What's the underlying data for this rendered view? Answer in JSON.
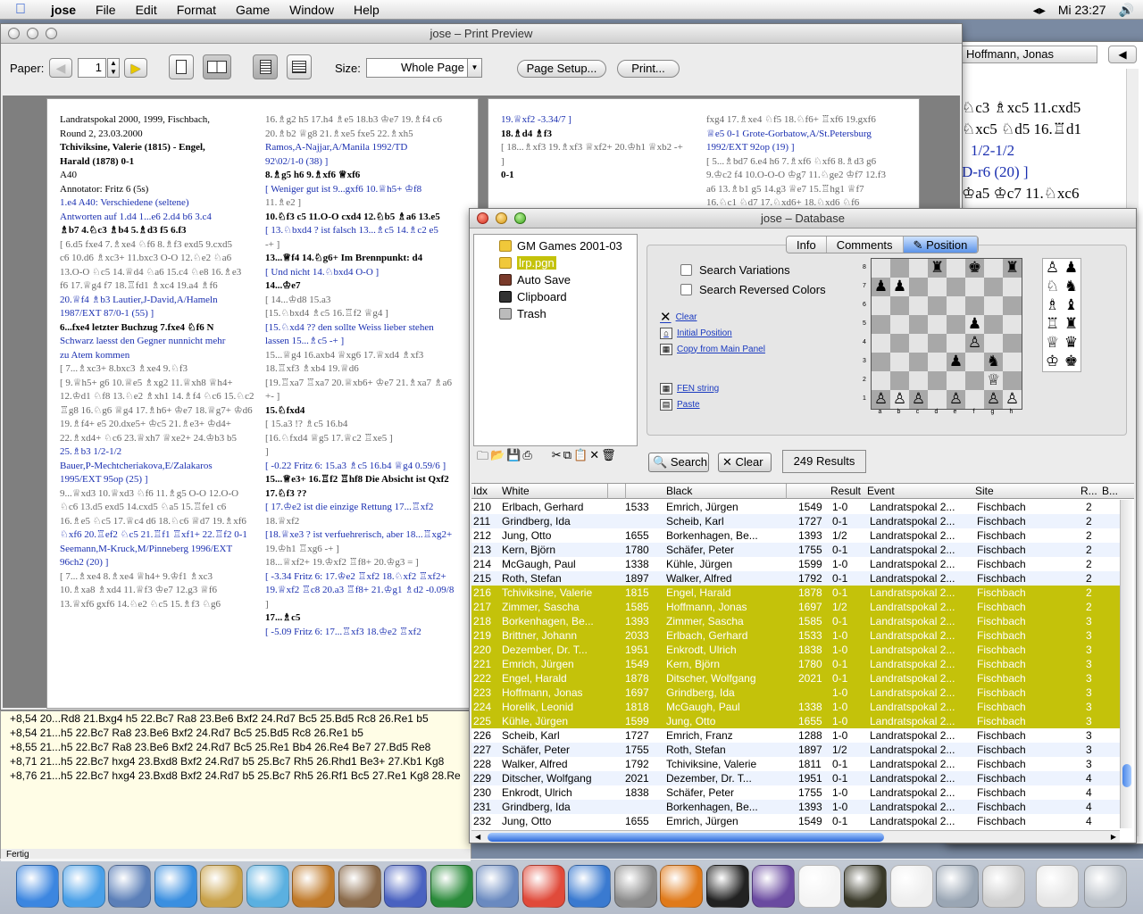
{
  "menubar": {
    "app": "jose",
    "items": [
      "File",
      "Edit",
      "Format",
      "Game",
      "Window",
      "Help"
    ],
    "clock": "Mi 23:27"
  },
  "print": {
    "title": "jose – Print Preview",
    "paper_label": "Paper:",
    "page_value": "1",
    "size_label": "Size:",
    "size_value": "Whole Page",
    "setup": "Page Setup...",
    "print": "Print..."
  },
  "page1": {
    "left": [
      {
        "t": "Landratspokal 2000, 1999, Fischbach,",
        "c": ""
      },
      {
        "t": "Round 2, 23.03.2000",
        "c": ""
      },
      {
        "t": "Tchiviksine, Valerie (1815)  - Engel,",
        "c": "b"
      },
      {
        "t": "Harald (1878)   0-1",
        "c": "b"
      },
      {
        "t": "A40",
        "c": ""
      },
      {
        "t": "",
        "c": ""
      },
      {
        "t": "Annotator: Fritz 6 (5s)",
        "c": ""
      },
      {
        "t": "",
        "c": ""
      },
      {
        "t": "1.e4 A40: Verschiedene (seltene)",
        "c": "blue"
      },
      {
        "t": "Antworten auf 1.d4 1...e6 2.d4 b6 3.c4",
        "c": "blue"
      },
      {
        "t": "♗b7 4.♘c3 ♗b4 5.♗d3 f5 6.f3",
        "c": "b"
      },
      {
        "t": "[ 6.d5 fxe4 7.♗xe4 ♘f6 8.♗f3 exd5 9.cxd5",
        "c": "grey"
      },
      {
        "t": "c6 10.d6 ♗xc3+ 11.bxc3 O-O 12.♘e2 ♘a6",
        "c": "grey"
      },
      {
        "t": "13.O-O ♘c5 14.♕d4 ♘a6 15.c4 ♘e8 16.♗e3",
        "c": "grey"
      },
      {
        "t": "f6 17.♕g4 f7 18.♖fd1 ♗xc4 19.a4 ♗f6",
        "c": "grey"
      },
      {
        "t": "20.♕f4 ♗b3  Lautier,J-David,A/Hameln",
        "c": "blue"
      },
      {
        "t": "1987/EXT 87/0-1 (55) ]",
        "c": "blue"
      },
      {
        "t": "6...fxe4 letzter Buchzug  7.fxe4 ♘f6 N",
        "c": "b"
      },
      {
        "t": "Schwarz laesst den Gegner nunnicht mehr",
        "c": "blue"
      },
      {
        "t": "zu Atem kommen",
        "c": "blue"
      },
      {
        "t": "[ 7...♗xc3+ 8.bxc3 ♗xe4 9.♘f3",
        "c": "grey"
      },
      {
        "t": "[ 9.♕h5+ g6 10.♕e5 ♗xg2 11.♕xh8 ♕h4+",
        "c": "grey"
      },
      {
        "t": "12.♔d1 ♘f8 13.♘e2 ♗xh1 14.♗f4 ♘c6 15.♘c2",
        "c": "grey"
      },
      {
        "t": "♖g8 16.♘g6 ♕g4 17.♗h6+ ♔e7 18.♕g7+ ♔d6",
        "c": "grey"
      },
      {
        "t": "19.♗f4+ e5 20.dxe5+ ♔c5 21.♗e3+ ♔d4+",
        "c": "grey"
      },
      {
        "t": "22.♗xd4+ ♘c6 23.♕xh7 ♕xe2+ 24.♔b3 b5",
        "c": "grey"
      },
      {
        "t": "25.♗b3 1/2-1/2",
        "c": "blue"
      },
      {
        "t": "Bauer,P-Mechtcheriakova,E/Zalakaros",
        "c": "blue"
      },
      {
        "t": "1995/EXT 95op (25) ]",
        "c": "blue"
      },
      {
        "t": "9...♕xd3 10.♕xd3 ♘f6 11.♗g5 O-O 12.O-O",
        "c": "grey"
      },
      {
        "t": "♘c6 13.d5 exd5 14.cxd5 ♘a5 15.♖fe1 c6",
        "c": "grey"
      },
      {
        "t": "16.♗e5 ♘c5 17.♕c4 d6 18.♘c6 ♕d7 19.♗xf6",
        "c": "grey"
      },
      {
        "t": "♘xf6 20.♖ef2 ♘c5 21.♖f1 ♖xf1+ 22.♖f2 0-1",
        "c": "blue"
      },
      {
        "t": "Seemann,M-Kruck,M/Pinneberg 1996/EXT",
        "c": "blue"
      },
      {
        "t": "96ch2 (20) ]",
        "c": "blue"
      },
      {
        "t": "[ 7...♗xe4 8.♗xe4 ♕h4+ 9.♔f1 ♗xc3",
        "c": "grey"
      },
      {
        "t": "10.♗xa8 ♗xd4 11.♕f3 ♔e7 12.g3 ♕f6",
        "c": "grey"
      },
      {
        "t": "13.♕xf6 gxf6 14.♘e2 ♘c5 15.♗f3 ♘g6",
        "c": "grey"
      }
    ],
    "right": [
      {
        "t": "16.♗g2 h5 17.h4 ♗e5 18.b3 ♔e7 19.♗f4 c6",
        "c": "grey"
      },
      {
        "t": "20.♗b2 ♕g8 21.♗xe5 fxe5 22.♗xh5",
        "c": "grey"
      },
      {
        "t": "Ramos,A-Najjar,A/Manila 1992/TD",
        "c": "blue"
      },
      {
        "t": "92\\02/1-0 (38) ]",
        "c": "blue"
      },
      {
        "t": "8.♗g5 h6 9.♗xf6 ♕xf6",
        "c": "b"
      },
      {
        "t": "[ Weniger gut ist 9...gxf6 10.♕h5+ ♔f8",
        "c": "blue"
      },
      {
        "t": "11.♗e2 ]",
        "c": "grey"
      },
      {
        "t": "10.♘f3 c5 11.O-O cxd4 12.♘b5 ♗a6 13.e5",
        "c": "b"
      },
      {
        "t": "[ 13.♘bxd4 ? ist falsch 13...♗c5 14.♗c2 e5",
        "c": "blue"
      },
      {
        "t": "-+ ]",
        "c": "grey"
      },
      {
        "t": "13...♕f4 14.♘g6+ Im Brennpunkt: d4",
        "c": "b"
      },
      {
        "t": "[ Und nicht 14.♘bxd4 O-O ]",
        "c": "blue"
      },
      {
        "t": "14...♔e7",
        "c": "b"
      },
      {
        "t": "[ 14...♔d8 15.a3",
        "c": "grey"
      },
      {
        "t": "[15.♘bxd4 ♗c5 16.♖f2 ♕g4 ]",
        "c": "grey"
      },
      {
        "t": "[15.♘xd4 ?? den sollte Weiss lieber stehen",
        "c": "blue"
      },
      {
        "t": "lassen 15...♗c5 -+ ]",
        "c": "blue"
      },
      {
        "t": "15...♕g4 16.axb4 ♕xg6 17.♕xd4 ♗xf3",
        "c": "grey"
      },
      {
        "t": "18.♖xf3 ♗xb4 19.♕d6",
        "c": "grey"
      },
      {
        "t": "[19.♖xa7 ♖xa7 20.♕xb6+ ♔e7 21.♗xa7 ♗a6",
        "c": "grey"
      },
      {
        "t": "+- ]",
        "c": "grey"
      },
      {
        "t": "",
        "c": ""
      },
      {
        "t": "15.♘fxd4",
        "c": "b"
      },
      {
        "t": "[ 15.a3 !? ♗c5 16.b4",
        "c": "grey"
      },
      {
        "t": "[16.♘fxd4 ♕g5 17.♕c2 ♖xe5 ]",
        "c": "grey"
      },
      {
        "t": "]",
        "c": "grey"
      },
      {
        "t": "[ -0.22 Fritz 6: 15.a3 ♗c5 16.b4 ♕g4 0.59/6 ]",
        "c": "blue"
      },
      {
        "t": "15...♕e3+ 16.♖f2 ♖hf8 Die Absicht ist Qxf2",
        "c": "b"
      },
      {
        "t": "17.♘f3 ??",
        "c": "b"
      },
      {
        "t": "[ 17.♔e2 ist die einzige Rettung 17...♖xf2",
        "c": "blue"
      },
      {
        "t": "18.♕xf2",
        "c": "grey"
      },
      {
        "t": "[18.♕xe3 ? ist verfuehrerisch, aber 18...♖xg2+",
        "c": "blue"
      },
      {
        "t": "19.♔h1 ♖xg6 -+ ]",
        "c": "grey"
      },
      {
        "t": "18...♕xf2+ 19.♔xf2 ♖f8+ 20.♔g3 = ]",
        "c": "grey"
      },
      {
        "t": "[ -3.34 Fritz 6: 17.♔e2 ♖xf2 18.♘xf2 ♖xf2+",
        "c": "blue"
      },
      {
        "t": "19.♕xf2 ♖c8 20.a3 ♖f8+ 21.♔g1 ♗d2 -0.09/8",
        "c": "blue"
      },
      {
        "t": "]",
        "c": "grey"
      },
      {
        "t": "17...♗c5",
        "c": "b"
      },
      {
        "t": "[ -5.09 Fritz 6: 17...♖xf3 18.♔e2 ♖xf2",
        "c": "blue"
      }
    ]
  },
  "page2": {
    "left": [
      {
        "t": "19.♕xf2 -3.34/7 ]",
        "c": "blue"
      },
      {
        "t": "18.♗d4 ♗f3",
        "c": "b"
      },
      {
        "t": "[ 18...♗xf3 19.♗xf3 ♕xf2+ 20.♔h1 ♕xb2 -+",
        "c": "grey"
      },
      {
        "t": "]",
        "c": "grey"
      },
      {
        "t": "0-1",
        "c": "b"
      }
    ],
    "right": [
      {
        "t": "fxg4 17.♗xe4 ♘f5 18.♘f6+ ♖xf6 19.gxf6",
        "c": "grey"
      },
      {
        "t": "♕e5 0-1 Grote-Gorbatow,A/St.Petersburg",
        "c": "blue"
      },
      {
        "t": "1992/EXT 92op (19) ]",
        "c": "blue"
      },
      {
        "t": "[ 5...♗bd7 6.e4 h6 7.♗xf6 ♘xf6 8.♗d3 g6",
        "c": "grey"
      },
      {
        "t": "9.♔c2 f4 10.O-O-O ♔g7 11.♘ge2 ♔f7 12.f3",
        "c": "grey"
      },
      {
        "t": "a6 13.♗b1 g5 14.g3 ♕e7 15.♖hg1 ♕f7",
        "c": "grey"
      },
      {
        "t": "16.♘c1 ♘d7 17.♘xd6+ 18.♘xd6 ♘f6",
        "c": "grey"
      }
    ]
  },
  "sidebar": {
    "player": "Hoffmann, Jonas",
    "lines": [
      "♘c3 ♗xc5 11.cxd5",
      "♘xc5 ♘d5 16.♖d1",
      "1/2-1/2",
      "D-r6 (20) ]",
      "♔a5 ♔c7 11.♘xc6"
    ]
  },
  "analysis": {
    "lines": [
      "+8,54 20...Rd8 21.Bxg4 h5 22.Bc7 Ra8 23.Be6 Bxf2 24.Rd7 Bc5 25.Bd5 Rc8 26.Re1 b5",
      "+8,54 21...h5 22.Bc7 Ra8 23.Be6 Bxf2 24.Rd7 Bc5 25.Bd5 Rc8 26.Re1 b5",
      "+8,55 21...h5 22.Bc7 Ra8 23.Be6 Bxf2 24.Rd7 Bc5 25.Re1 Bb4 26.Re4 Be7 27.Bd5 Re8",
      "+8,71 21...h5 22.Bc7 hxg4 23.Bxd8 Bxf2 24.Rd7 b5 25.Bc7 Rh5 26.Rhd1 Be3+ 27.Kb1 Kg8",
      "+8,76 21...h5 22.Bc7 hxg4 23.Bxd8 Bxf2 24.Rd7 b5 25.Bc7 Rh5 26.Rf1 Bc5 27.Re1 Kg8 28.Re"
    ],
    "status": "Fertig"
  },
  "db": {
    "title": "jose – Database",
    "tree": [
      {
        "label": "GM Games 2001-03"
      },
      {
        "label": "lrp.pgn"
      },
      {
        "label": "Auto Save"
      },
      {
        "label": "Clipboard"
      },
      {
        "label": "Trash"
      }
    ],
    "tabs": [
      "Info",
      "Comments",
      "Position"
    ],
    "opt1": "Search Variations",
    "opt2": "Search Reversed Colors",
    "links": [
      "Clear",
      "Initial Position",
      "Copy from Main Panel",
      "FEN string",
      "Paste"
    ],
    "search": "Search",
    "clear": "Clear",
    "results": "249 Results",
    "headers": [
      "Idx",
      "White",
      "",
      "Black",
      "",
      "Result",
      "Event",
      "Site",
      "R...",
      "B..."
    ],
    "board": [
      [
        "",
        "",
        "",
        "♜",
        "",
        "♚",
        "",
        "♜"
      ],
      [
        "♟",
        "♟",
        "",
        "",
        "",
        "",
        "",
        ""
      ],
      [
        "",
        "",
        "",
        "",
        "",
        "",
        "",
        ""
      ],
      [
        "",
        "",
        "",
        "",
        "",
        "♟",
        "",
        ""
      ],
      [
        "",
        "",
        "",
        "",
        "",
        "♙",
        "",
        ""
      ],
      [
        "",
        "",
        "",
        "",
        "♟",
        "",
        "♞",
        ""
      ],
      [
        "",
        "",
        "",
        "",
        "",
        "",
        "♕",
        ""
      ],
      [
        "♙",
        "♙",
        "♙",
        "",
        "♙",
        "",
        "♙",
        "♙"
      ],
      [
        "",
        "",
        "♔",
        "♖",
        "",
        "",
        "",
        "♖"
      ]
    ],
    "palette": [
      [
        "♙",
        "♟"
      ],
      [
        "♘",
        "♞"
      ],
      [
        "♗",
        "♝"
      ],
      [
        "♖",
        "♜"
      ],
      [
        "♕",
        "♛"
      ],
      [
        "♔",
        "♚"
      ]
    ],
    "rank_labels": [
      "8",
      "7",
      "6",
      "5",
      "4",
      "3",
      "2",
      "1"
    ],
    "file_labels": [
      "a",
      "b",
      "c",
      "d",
      "e",
      "f",
      "g",
      "h"
    ],
    "rows": [
      {
        "i": "210",
        "w": "Erlbach, Gerhard",
        "we": "1533",
        "b": "Emrich, Jürgen",
        "be": "1549",
        "r": "1-0",
        "e": "Landratspokal 2...",
        "s": "Fischbach",
        "rd": "2",
        "sel": false
      },
      {
        "i": "211",
        "w": "Grindberg, Ida",
        "we": "",
        "b": "Scheib, Karl",
        "be": "1727",
        "r": "0-1",
        "e": "Landratspokal 2...",
        "s": "Fischbach",
        "rd": "2",
        "sel": false
      },
      {
        "i": "212",
        "w": "Jung, Otto",
        "we": "1655",
        "b": "Borkenhagen, Be...",
        "be": "1393",
        "r": "1/2",
        "e": "Landratspokal 2...",
        "s": "Fischbach",
        "rd": "2",
        "sel": false
      },
      {
        "i": "213",
        "w": "Kern, Björn",
        "we": "1780",
        "b": "Schäfer, Peter",
        "be": "1755",
        "r": "0-1",
        "e": "Landratspokal 2...",
        "s": "Fischbach",
        "rd": "2",
        "sel": false
      },
      {
        "i": "214",
        "w": "McGaugh, Paul",
        "we": "1338",
        "b": "Kühle, Jürgen",
        "be": "1599",
        "r": "1-0",
        "e": "Landratspokal 2...",
        "s": "Fischbach",
        "rd": "2",
        "sel": false
      },
      {
        "i": "215",
        "w": "Roth, Stefan",
        "we": "1897",
        "b": "Walker, Alfred",
        "be": "1792",
        "r": "0-1",
        "e": "Landratspokal 2...",
        "s": "Fischbach",
        "rd": "2",
        "sel": false
      },
      {
        "i": "216",
        "w": "Tchiviksine, Valerie",
        "we": "1815",
        "b": "Engel, Harald",
        "be": "1878",
        "r": "0-1",
        "e": "Landratspokal 2...",
        "s": "Fischbach",
        "rd": "2",
        "sel": true
      },
      {
        "i": "217",
        "w": "Zimmer, Sascha",
        "we": "1585",
        "b": "Hoffmann, Jonas",
        "be": "1697",
        "r": "1/2",
        "e": "Landratspokal 2...",
        "s": "Fischbach",
        "rd": "2",
        "sel": true
      },
      {
        "i": "218",
        "w": "Borkenhagen, Be...",
        "we": "1393",
        "b": "Zimmer, Sascha",
        "be": "1585",
        "r": "0-1",
        "e": "Landratspokal 2...",
        "s": "Fischbach",
        "rd": "3",
        "sel": true
      },
      {
        "i": "219",
        "w": "Brittner, Johann",
        "we": "2033",
        "b": "Erlbach, Gerhard",
        "be": "1533",
        "r": "1-0",
        "e": "Landratspokal 2...",
        "s": "Fischbach",
        "rd": "3",
        "sel": true
      },
      {
        "i": "220",
        "w": "Dezember, Dr. T...",
        "we": "1951",
        "b": "Enkrodt, Ulrich",
        "be": "1838",
        "r": "1-0",
        "e": "Landratspokal 2...",
        "s": "Fischbach",
        "rd": "3",
        "sel": true
      },
      {
        "i": "221",
        "w": "Emrich, Jürgen",
        "we": "1549",
        "b": "Kern, Björn",
        "be": "1780",
        "r": "0-1",
        "e": "Landratspokal 2...",
        "s": "Fischbach",
        "rd": "3",
        "sel": true
      },
      {
        "i": "222",
        "w": "Engel, Harald",
        "we": "1878",
        "b": "Ditscher, Wolfgang",
        "be": "2021",
        "r": "0-1",
        "e": "Landratspokal 2...",
        "s": "Fischbach",
        "rd": "3",
        "sel": true
      },
      {
        "i": "223",
        "w": "Hoffmann, Jonas",
        "we": "1697",
        "b": "Grindberg, Ida",
        "be": "",
        "r": "1-0",
        "e": "Landratspokal 2...",
        "s": "Fischbach",
        "rd": "3",
        "sel": true
      },
      {
        "i": "224",
        "w": "Horelik, Leonid",
        "we": "1818",
        "b": "McGaugh, Paul",
        "be": "1338",
        "r": "1-0",
        "e": "Landratspokal 2...",
        "s": "Fischbach",
        "rd": "3",
        "sel": true
      },
      {
        "i": "225",
        "w": "Kühle, Jürgen",
        "we": "1599",
        "b": "Jung, Otto",
        "be": "1655",
        "r": "1-0",
        "e": "Landratspokal 2...",
        "s": "Fischbach",
        "rd": "3",
        "sel": true
      },
      {
        "i": "226",
        "w": "Scheib, Karl",
        "we": "1727",
        "b": "Emrich, Franz",
        "be": "1288",
        "r": "1-0",
        "e": "Landratspokal 2...",
        "s": "Fischbach",
        "rd": "3",
        "sel": false
      },
      {
        "i": "227",
        "w": "Schäfer, Peter",
        "we": "1755",
        "b": "Roth, Stefan",
        "be": "1897",
        "r": "1/2",
        "e": "Landratspokal 2...",
        "s": "Fischbach",
        "rd": "3",
        "sel": false
      },
      {
        "i": "228",
        "w": "Walker, Alfred",
        "we": "1792",
        "b": "Tchiviksine, Valerie",
        "be": "1811",
        "r": "0-1",
        "e": "Landratspokal 2...",
        "s": "Fischbach",
        "rd": "3",
        "sel": false
      },
      {
        "i": "229",
        "w": "Ditscher, Wolfgang",
        "we": "2021",
        "b": "Dezember, Dr. T...",
        "be": "1951",
        "r": "0-1",
        "e": "Landratspokal 2...",
        "s": "Fischbach",
        "rd": "4",
        "sel": false
      },
      {
        "i": "230",
        "w": "Enkrodt, Ulrich",
        "we": "1838",
        "b": "Schäfer, Peter",
        "be": "1755",
        "r": "1-0",
        "e": "Landratspokal 2...",
        "s": "Fischbach",
        "rd": "4",
        "sel": false
      },
      {
        "i": "231",
        "w": "Grindberg, Ida",
        "we": "",
        "b": "Borkenhagen, Be...",
        "be": "1393",
        "r": "1-0",
        "e": "Landratspokal 2...",
        "s": "Fischbach",
        "rd": "4",
        "sel": false
      },
      {
        "i": "232",
        "w": "Jung, Otto",
        "we": "1655",
        "b": "Emrich, Jürgen",
        "be": "1549",
        "r": "0-1",
        "e": "Landratspokal 2...",
        "s": "Fischbach",
        "rd": "4",
        "sel": false
      }
    ]
  },
  "dock": [
    {
      "icon": "finder-icon",
      "color": "#3c86e0"
    },
    {
      "icon": "safari-icon",
      "color": "#4aa0e8"
    },
    {
      "icon": "mail-icon",
      "color": "#5b7fb8"
    },
    {
      "icon": "ichat-icon",
      "color": "#3a8fe0"
    },
    {
      "icon": "address-book-icon",
      "color": "#c9a24a"
    },
    {
      "icon": "itunes-icon",
      "color": "#5bb0e0"
    },
    {
      "icon": "garageband-icon",
      "color": "#c07a2a"
    },
    {
      "icon": "iphoto-icon",
      "color": "#8a6a4a"
    },
    {
      "icon": "imovie-icon",
      "color": "#4a62c0"
    },
    {
      "icon": "jose-knight-icon",
      "color": "#2a8a3a"
    },
    {
      "icon": "idvd-icon",
      "color": "#6a8ac0"
    },
    {
      "icon": "ical-icon",
      "color": "#e04a3a"
    },
    {
      "icon": "quicktime-icon",
      "color": "#3a7ad0"
    },
    {
      "icon": "system-preferences-icon",
      "color": "#8a8a8a"
    },
    {
      "icon": "firefox-icon",
      "color": "#e07a1a"
    },
    {
      "icon": "terminal-icon",
      "color": "#222222"
    },
    {
      "icon": "stuffit-icon",
      "color": "#6a4aa0"
    },
    {
      "icon": "xml-document-icon",
      "color": "#f4f4f4"
    },
    {
      "icon": "console-icon",
      "color": "#3a3a2a"
    },
    {
      "icon": "text-edit-icon",
      "color": "#eeeeee"
    },
    {
      "icon": "help-icon",
      "color": "#9aa6b4"
    },
    {
      "icon": "utility-icon",
      "color": "#d0d0d0"
    },
    {
      "icon": "minimized-window-icon",
      "color": "#e6e6e6"
    },
    {
      "icon": "trash-icon",
      "color": "#bfc5cc"
    }
  ]
}
